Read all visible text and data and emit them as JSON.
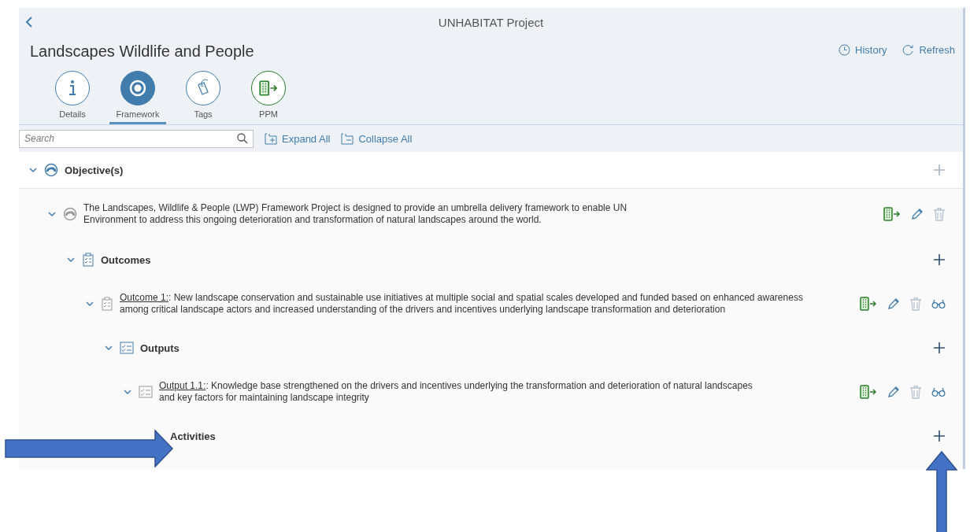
{
  "header": {
    "subtitle": "UNHABITAT Project",
    "title": "Landscapes Wildlife and People",
    "actions": [
      {
        "kind": "history",
        "label": "History"
      },
      {
        "kind": "refresh",
        "label": "Refresh"
      }
    ]
  },
  "tabs": [
    {
      "kind": "info",
      "label": "Details",
      "selected": false
    },
    {
      "kind": "target",
      "label": "Framework",
      "selected": true
    },
    {
      "kind": "tag",
      "label": "Tags",
      "selected": false
    },
    {
      "kind": "ppm",
      "label": "PPM",
      "selected": false
    }
  ],
  "toolbar": {
    "search": {
      "placeholder": "Search"
    },
    "buttons": [
      {
        "kind": "expand",
        "label": "Expand All"
      },
      {
        "kind": "collapse",
        "label": "Collapse All"
      }
    ]
  },
  "tree": [
    {
      "kind": "objectives",
      "label": "Objective(s)",
      "expanded": true,
      "add_disabled": true,
      "children": [
        {
          "kind": "objective",
          "expanded": true,
          "text": "The Landscapes, Wildlife & People (LWP) Framework Project is designed to provide an umbrella delivery framework to enable UN Environment to address this ongoing deterioration and transformation of natural landscapes around the world.",
          "actions": [
            {
              "kind": "ppm"
            },
            {
              "kind": "edit"
            },
            {
              "kind": "delete"
            }
          ],
          "children": [
            {
              "kind": "outcomes",
              "label": "Outcomes",
              "expanded": true,
              "add_disabled": false,
              "children": [
                {
                  "kind": "outcome",
                  "expanded": true,
                  "ref": "Outcome 1:",
                  "text": ": New landscape conservation and sustainable use initiatives at multiple social and spatial scales developed and funded based on enhanced awareness among critical landscape actors and increased understanding of the drivers and incentives underlying landscape transformation and deterioration",
                  "actions": [
                    {
                      "kind": "ppm"
                    },
                    {
                      "kind": "edit"
                    },
                    {
                      "kind": "delete"
                    },
                    {
                      "kind": "view"
                    }
                  ],
                  "children": [
                    {
                      "kind": "outputs",
                      "label": "Outputs",
                      "expanded": true,
                      "add_disabled": false,
                      "children": [
                        {
                          "kind": "output",
                          "expanded": true,
                          "ref": "Output 1.1:",
                          "text": ": Knowledge base strengthened on the drivers and incentives underlying the transformation and deterioration of natural landscapes and key factors for maintaining landscape integrity",
                          "actions": [
                            {
                              "kind": "ppm"
                            },
                            {
                              "kind": "edit"
                            },
                            {
                              "kind": "delete"
                            },
                            {
                              "kind": "view"
                            }
                          ],
                          "children": [
                            {
                              "kind": "activities",
                              "label": "Activities",
                              "add_disabled": false
                            }
                          ]
                        }
                      ]
                    }
                  ]
                }
              ]
            }
          ]
        }
      ]
    }
  ]
}
